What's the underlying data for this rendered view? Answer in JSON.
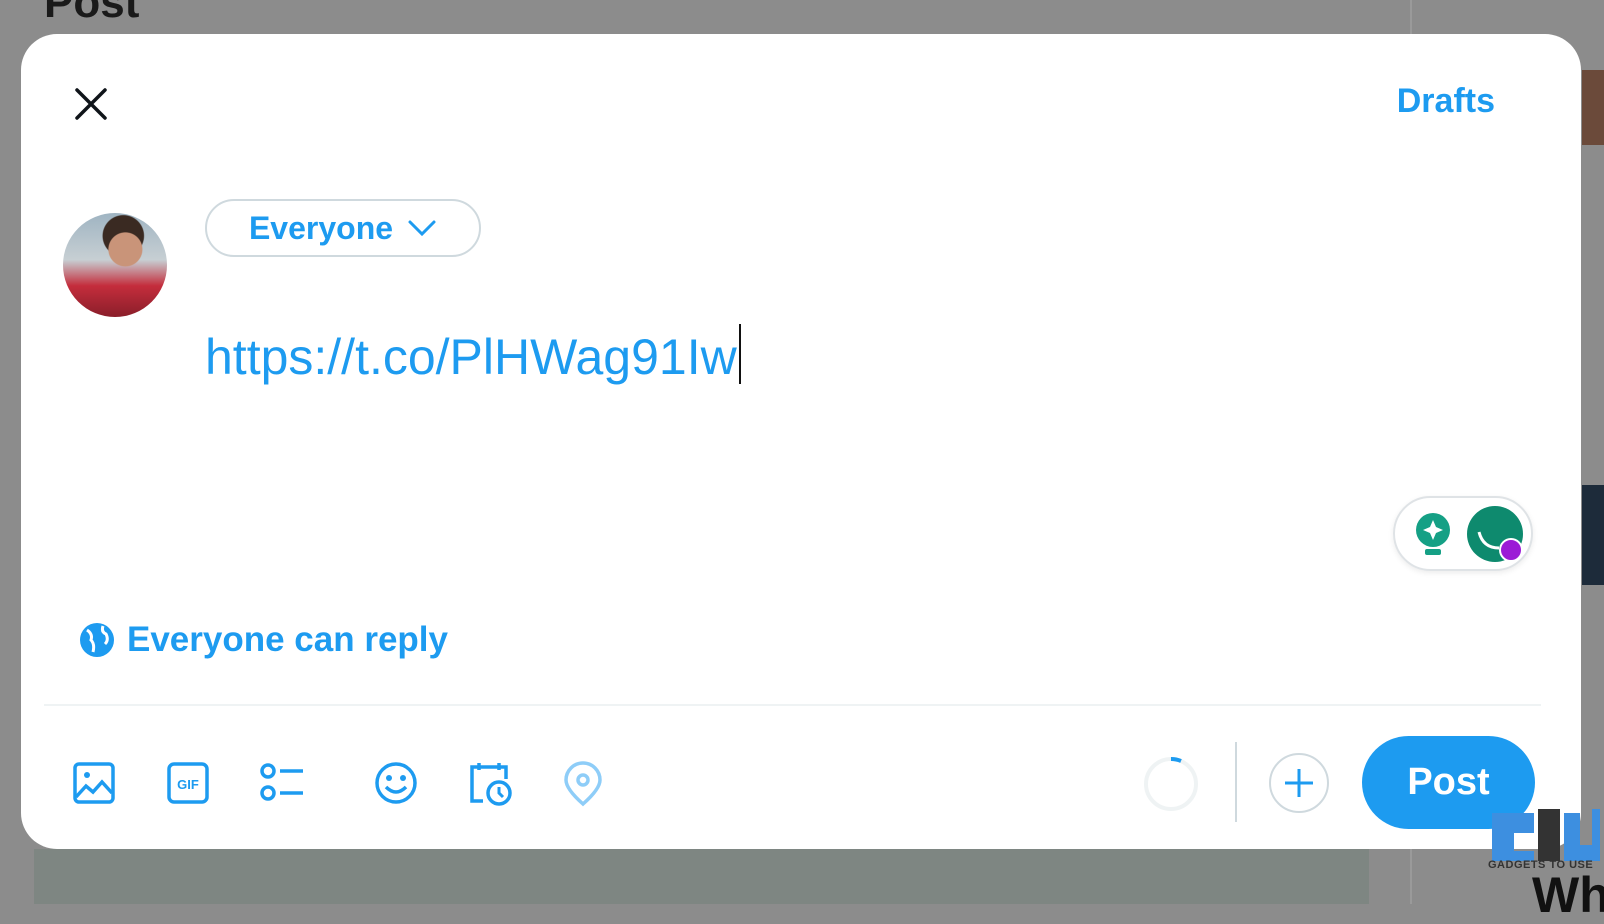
{
  "background": {
    "title": "Post",
    "partial_text": "Wh"
  },
  "modal": {
    "close_icon": "close-icon",
    "drafts_label": "Drafts",
    "audience_label": "Everyone",
    "compose_text": "https://t.co/PlHWag91Iw",
    "reply_setting_label": "Everyone can reply",
    "toolbar": {
      "icons": [
        "image-icon",
        "gif-icon",
        "poll-icon",
        "emoji-icon",
        "schedule-icon",
        "location-icon"
      ],
      "gif_text": "GIF",
      "post_label": "Post"
    }
  },
  "watermark": {
    "text": "GADGETS TO USE"
  },
  "colors": {
    "accent": "#1d9bf0",
    "grammarly": "#15a085",
    "grammarly_dot": "#9b1bd6"
  }
}
